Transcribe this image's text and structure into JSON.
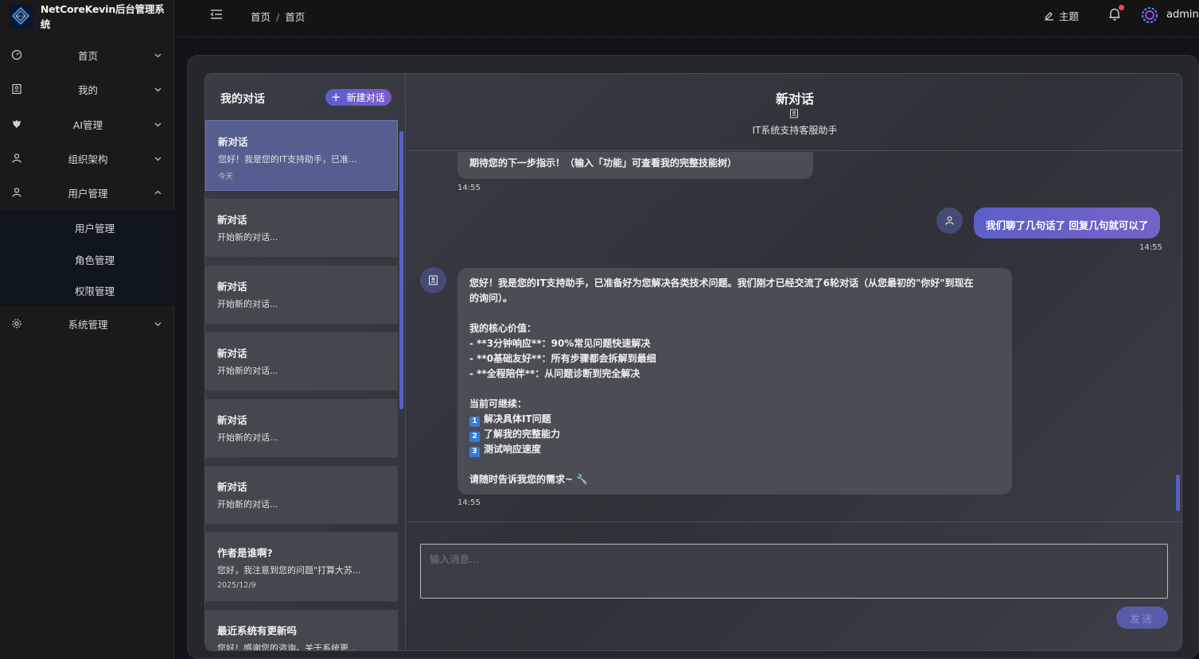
{
  "app": {
    "title": "NetCoreKevin后台管理系统"
  },
  "sidebar": {
    "items": [
      {
        "label": "首页",
        "icon": "dashboard-icon"
      },
      {
        "label": "我的",
        "icon": "profile-card-icon"
      },
      {
        "label": "AI管理",
        "icon": "ai-logo-icon"
      },
      {
        "label": "组织架构",
        "icon": "user-icon"
      },
      {
        "label": "用户管理",
        "icon": "user-icon"
      },
      {
        "label": "系统管理",
        "icon": "gear-icon"
      }
    ],
    "submenu": [
      "用户管理",
      "角色管理",
      "权限管理"
    ]
  },
  "header": {
    "breadcrumb": [
      "首页",
      "首页"
    ],
    "theme_label": "主题",
    "user_name": "admin"
  },
  "conversations": {
    "title": "我的对话",
    "new_button": "新建对话",
    "items": [
      {
        "title": "新对话",
        "preview": "您好！我是您的IT支持助手，已准...",
        "date": "今天"
      },
      {
        "title": "新对话",
        "preview": "开始新的对话..."
      },
      {
        "title": "新对话",
        "preview": "开始新的对话..."
      },
      {
        "title": "新对话",
        "preview": "开始新的对话..."
      },
      {
        "title": "新对话",
        "preview": "开始新的对话..."
      },
      {
        "title": "新对话",
        "preview": "开始新的对话..."
      },
      {
        "title": "作者是谁啊?",
        "preview": "您好，我注意到您的问题\"打算大苏...",
        "date": "2025/12/9"
      },
      {
        "title": "最近系统有更新吗",
        "preview": "您好！感谢您的咨询。关于系统更..."
      }
    ]
  },
  "chat": {
    "title": "新对话",
    "subtitle": "IT系统支持客服助手",
    "messages": [
      {
        "role": "bot",
        "lines": [
          "期待您的下一步指示！（输入「功能」可查看我的完整技能树）"
        ],
        "time": "14:55"
      },
      {
        "role": "user",
        "text": "我们聊了几句话了 回复几句就可以了",
        "time": "14:55"
      },
      {
        "role": "bot",
        "lines": [
          "您好！我是您的IT支持助手，已准备好为您解决各类技术问题。我们刚才已经交流了6轮对话（从您最初的\"你好\"到现在",
          "的询问）。",
          "",
          "我的核心价值：",
          "- **3分钟响应**：90%常见问题快速解决",
          "- **0基础友好**：所有步骤都会拆解到最细",
          "- **全程陪伴**：从问题诊断到完全解决",
          "",
          "当前可继续：",
          "1 解决具体IT问题",
          "2 了解我的完整能力",
          "3 测试响应速度",
          "",
          "请随时告诉我您的需求~ 🔧"
        ],
        "time": "14:55"
      }
    ],
    "input_placeholder": "输入消息...",
    "send_label": "发送"
  }
}
